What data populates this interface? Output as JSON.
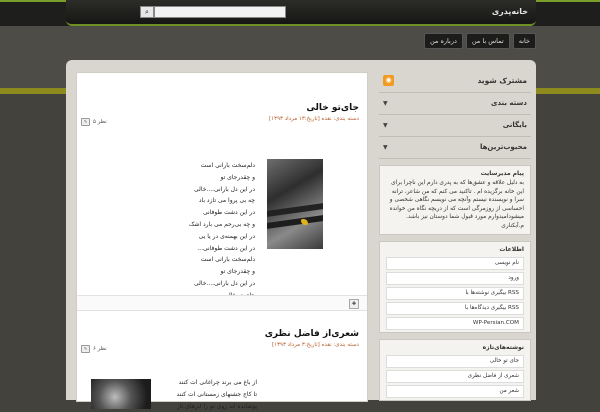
{
  "site": {
    "title": "خانه‌پدری"
  },
  "search": {
    "placeholder": "",
    "button_glyph": "⌕"
  },
  "nav": {
    "items": [
      "خانه",
      "تماس با من",
      "درباره من"
    ]
  },
  "posts": [
    {
      "title": "جای‌تو خالی",
      "meta": "[تاریخ:۱۳ مرداد ۱۳۹۳] دسته بندی: نقده",
      "comments": "۵ نظر",
      "lines": [
        "دلم‌سخت بارانی است",
        "و چقدرجای تو",
        "در این دل بارانی....خالی",
        "چه بی پروا می تازد باد",
        "در این دشت طوفانی",
        "و چه بی‌رحم می بارد اشک",
        "در این بهمنه‌ی در یا یی",
        "در این دشت طوفانی...",
        "دلم‌سخت بارانی است",
        "و چقدرجای تو",
        "در این دل بارانی....خالی",
        "جای تو خالی"
      ],
      "signature": "م.آبکناری| یادمان زمستان ۹۲"
    },
    {
      "title": "شعری‌از فاضل نظری",
      "meta": "[تاریخ:۳ مرداد ۱۳۹۳] دسته بندی: نقده",
      "comments": "۶ نظر",
      "lines": [
        "از باغ می برند چراغانی ات کنند",
        "تا کاج جشنهای زمستانی ات کنند",
        "پوشانده اند روی تو را ابرهای تار"
      ]
    }
  ],
  "sidebar": {
    "subscribe": "مشترک شوید",
    "menus": [
      "دسته بندی",
      "بایگانی",
      "محبوب‌ترین‌ها"
    ],
    "notice": {
      "title": "پیام مدیرسایت",
      "text": "به دلیل علاقه و عشق‌ها که به پدری دارم این ناچرا برای این خانه برگزیده ام . تاکنید می کنم که من شاعر، ترانه سرا و نویسنده نیستم وآنچه می نویسم نگاهی شخصی و احساسی از روزمرگی است که از دریچه نگاه من خوانده میشودامیدوارم مورد قبول شما دوستان نیز باشد. م.آبکناری"
    },
    "info": {
      "title": "اطلاعات",
      "items": [
        "نام‌ نویسی",
        "ورود",
        "بیگیری نوشته‌ها با RSS",
        "بیگیری دیدگاه‌ها با RSS",
        "WP-Persian.COM"
      ]
    },
    "recent": {
      "title": "نوشته‌های‌تازه",
      "items": [
        "جای تو خالی",
        "شعری از فاضل نظری",
        "شعر من"
      ]
    }
  },
  "colors": {
    "accent": "#7a9e2a",
    "meta": "#b8612f",
    "rss": "#f29b21"
  }
}
